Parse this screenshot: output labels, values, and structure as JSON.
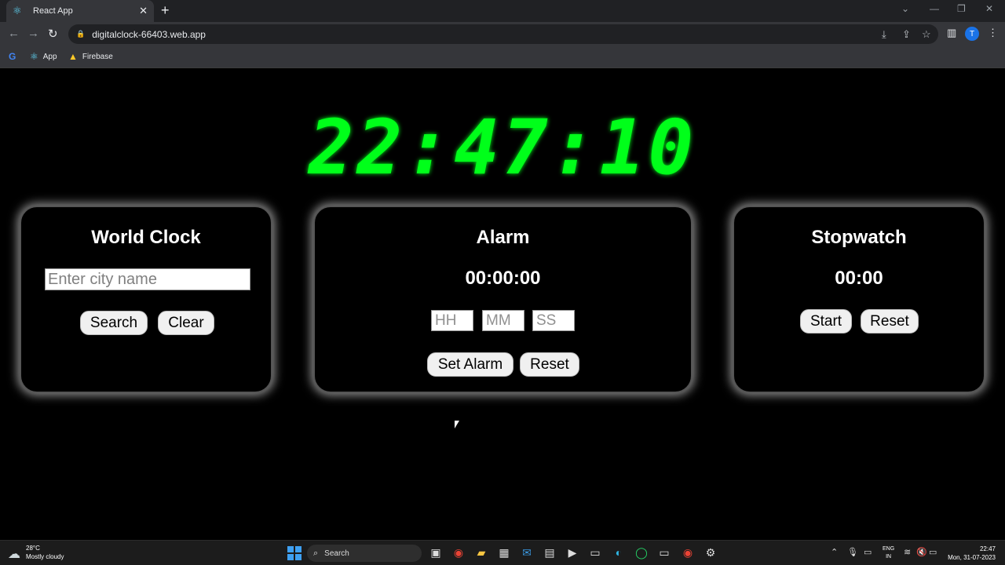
{
  "browser": {
    "tab_title": "React App",
    "url": "digitalclock-66403.web.app",
    "avatar_letter": "T",
    "bookmarks": [
      {
        "label": "App"
      },
      {
        "label": "Firebase"
      }
    ]
  },
  "clock": {
    "time": "22:47:10",
    "color": "#00ff1a"
  },
  "world_clock": {
    "title": "World Clock",
    "city_placeholder": "Enter city name",
    "search_label": "Search",
    "clear_label": "Clear"
  },
  "alarm": {
    "title": "Alarm",
    "time": "00:00:00",
    "hh_placeholder": "HH",
    "mm_placeholder": "MM",
    "ss_placeholder": "SS",
    "set_label": "Set Alarm",
    "reset_label": "Reset"
  },
  "stopwatch": {
    "title": "Stopwatch",
    "time": "00:00",
    "start_label": "Start",
    "reset_label": "Reset"
  },
  "taskbar": {
    "temperature": "28°C",
    "weather": "Mostly cloudy",
    "search_label": "Search",
    "language_line1": "ENG",
    "language_line2": "IN",
    "time": "22:47",
    "date": "Mon, 31-07-2023"
  }
}
